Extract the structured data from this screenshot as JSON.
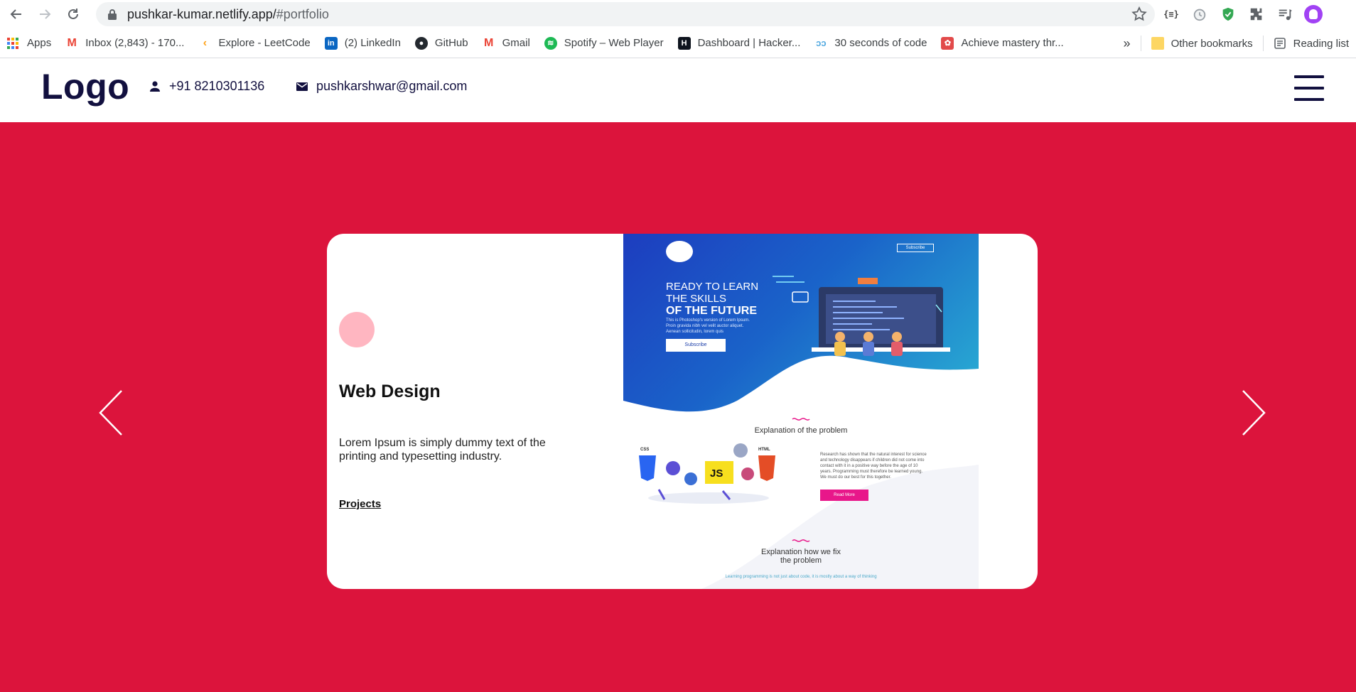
{
  "browser": {
    "url_host": "pushkar-kumar.netlify.app/",
    "url_path": "#portfolio",
    "extensions": [
      "json-viewer-icon",
      "timer-extension-icon",
      "shield-extension-icon",
      "puzzle-extensions-icon",
      "media-control-icon",
      "profile-avatar"
    ],
    "json_ext_label": "{≡}"
  },
  "bookmarks": {
    "items": [
      {
        "label": "Apps",
        "icon": "apps-grid-icon"
      },
      {
        "label": "Inbox (2,843) - 170...",
        "icon": "gmail-icon"
      },
      {
        "label": "Explore - LeetCode",
        "icon": "leetcode-icon"
      },
      {
        "label": "(2) LinkedIn",
        "icon": "linkedin-icon"
      },
      {
        "label": "GitHub",
        "icon": "github-icon"
      },
      {
        "label": "Gmail",
        "icon": "gmail-icon"
      },
      {
        "label": "Spotify – Web Player",
        "icon": "spotify-icon"
      },
      {
        "label": "Dashboard | Hacker...",
        "icon": "hackerrank-icon"
      },
      {
        "label": "30 seconds of code",
        "icon": "thirty-seconds-icon"
      },
      {
        "label": "Achieve mastery thr...",
        "icon": "openai-icon"
      }
    ],
    "overflow": "»",
    "other": "Other bookmarks",
    "reading_list": "Reading list"
  },
  "site": {
    "logo": "Logo",
    "phone": "+91 8210301136",
    "email": "pushkarshwar@gmail.com"
  },
  "card": {
    "title": "Web Design",
    "description": "Lorem Ipsum is simply dummy text of the printing and typesetting industry.",
    "link": "Projects"
  },
  "mockup": {
    "heading_line1": "READY TO LEARN",
    "heading_line2": "THE SKILLS",
    "heading_line3": "OF THE FUTURE",
    "subtext": "This is Photoshop's version of Lorem Ipsum. Proin gravida nibh vel velit auctor aliquet. Aenean sollicitudin, lorem quis",
    "subscribe": "Subscribe",
    "section1": "Explanation of the problem",
    "section1_text": "Research has shown that the natural interest for science and technology disappears if children did not come into contact with it in a positive way before the age of 10 years. Programming must therefore be learned young. We must do our best for this together.",
    "read_more": "Read More",
    "section2_line1": "Explanation how we fix",
    "section2_line2": "the problem",
    "footer_text": "Learning programming is not just about code, it is mostly about a way of thinking",
    "badge_css": "CSS",
    "badge_js": "JS",
    "badge_html": "HTML"
  },
  "colors": {
    "hero_bg": "#dc143c",
    "logo_text": "#12103f",
    "dot": "#ffb6c1"
  }
}
